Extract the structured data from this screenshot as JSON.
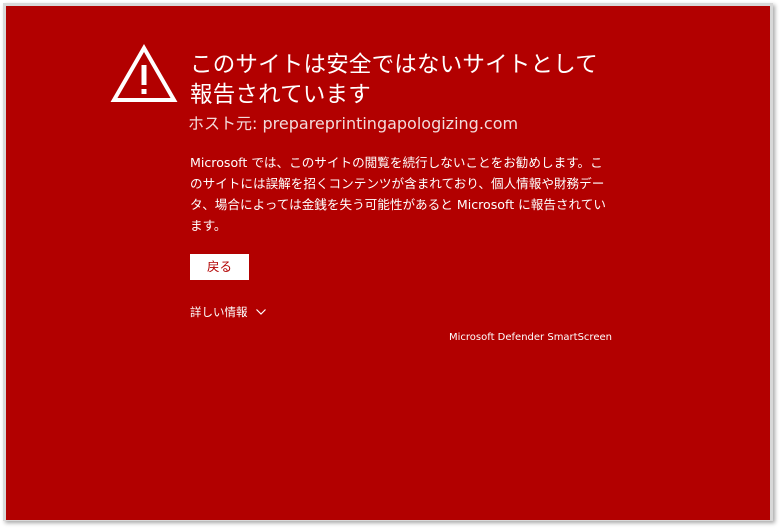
{
  "warning": {
    "icon": "warning-triangle-icon",
    "title": "このサイトは安全ではないサイトとして報告されています",
    "host_label": "ホスト元:",
    "host": "prepareprintingapologizing.com",
    "description": "Microsoft では、このサイトの閲覧を続行しないことをお勧めします。このサイトには誤解を招くコンテンツが含まれており、個人情報や財務データ、場合によっては金銭を失う可能性があると Microsoft に報告されています。"
  },
  "actions": {
    "back_label": "戻る",
    "details_label": "詳しい情報",
    "details_icon": "chevron-down-icon"
  },
  "footer": {
    "brand": "Microsoft Defender SmartScreen"
  },
  "colors": {
    "background": "#b20000",
    "text": "#ffffff",
    "button_background": "#ffffff",
    "button_text": "#b20000"
  }
}
